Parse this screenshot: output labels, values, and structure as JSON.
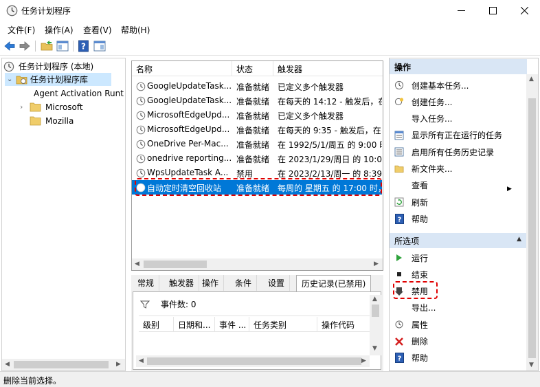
{
  "window": {
    "title": "任务计划程序",
    "minimize": "—",
    "maximize": "☐",
    "close": "✕"
  },
  "menu": [
    "文件(F)",
    "操作(A)",
    "查看(V)",
    "帮助(H)"
  ],
  "tree": {
    "root": "任务计划程序 (本地)",
    "library": "任务计划程序库",
    "children": [
      "Agent Activation Runtime",
      "Microsoft",
      "Mozilla"
    ]
  },
  "tasks": {
    "columns": [
      "名称",
      "状态",
      "触发器"
    ],
    "rows": [
      {
        "name": "GoogleUpdateTask...",
        "status": "准备就绪",
        "trigger": "已定义多个触发器"
      },
      {
        "name": "GoogleUpdateTask...",
        "status": "准备就绪",
        "trigger": "在每天的 14:12 - 触发后，在"
      },
      {
        "name": "MicrosoftEdgeUpd...",
        "status": "准备就绪",
        "trigger": "已定义多个触发器"
      },
      {
        "name": "MicrosoftEdgeUpd...",
        "status": "准备就绪",
        "trigger": "在每天的 9:35 - 触发后，在"
      },
      {
        "name": "OneDrive Per-Mac...",
        "status": "准备就绪",
        "trigger": "在 1992/5/1/周五 的 9:00 时"
      },
      {
        "name": "onedrive reporting...",
        "status": "准备就绪",
        "trigger": "在 2023/1/29/周日 的 10:04"
      },
      {
        "name": "WpsUpdateTask A...",
        "status": "禁用",
        "trigger": "在 2023/2/13/周一 的 8:39"
      },
      {
        "name": "自动定时清空回收站",
        "status": "准备就绪",
        "trigger": "每周的 星期五 的 17:00 时，"
      }
    ]
  },
  "detail_tabs": [
    "常规",
    "触发器",
    "操作",
    "条件",
    "设置",
    "历史记录(已禁用)"
  ],
  "history": {
    "event_count": "事件数: 0",
    "columns": [
      "级别",
      "日期和...",
      "事件 ...",
      "任务类别",
      "操作代码"
    ]
  },
  "actions": {
    "header": "操作",
    "items": [
      {
        "label": "创建基本任务...",
        "icon": "create-basic-task-icon"
      },
      {
        "label": "创建任务...",
        "icon": "create-task-icon"
      },
      {
        "label": "导入任务...",
        "icon": "import-icon"
      },
      {
        "label": "显示所有正在运行的任务",
        "icon": "running-tasks-icon"
      },
      {
        "label": "启用所有任务历史记录",
        "icon": "history-icon"
      },
      {
        "label": "新文件夹...",
        "icon": "folder-icon"
      },
      {
        "label": "查看",
        "icon": "view-icon"
      },
      {
        "label": "刷新",
        "icon": "refresh-icon"
      },
      {
        "label": "帮助",
        "icon": "help-icon"
      }
    ],
    "selected_header": "所选项",
    "selected_items": [
      {
        "label": "运行",
        "icon": "run-icon"
      },
      {
        "label": "结束",
        "icon": "stop-icon"
      },
      {
        "label": "禁用",
        "icon": "disable-icon"
      },
      {
        "label": "导出...",
        "icon": "export-icon"
      },
      {
        "label": "属性",
        "icon": "properties-icon"
      },
      {
        "label": "删除",
        "icon": "delete-icon"
      },
      {
        "label": "帮助",
        "icon": "help-icon"
      }
    ]
  },
  "status": "删除当前选择。",
  "colors": {
    "selection": "#0078d7",
    "highlight": "#e00000",
    "header": "#d9e6f5"
  }
}
